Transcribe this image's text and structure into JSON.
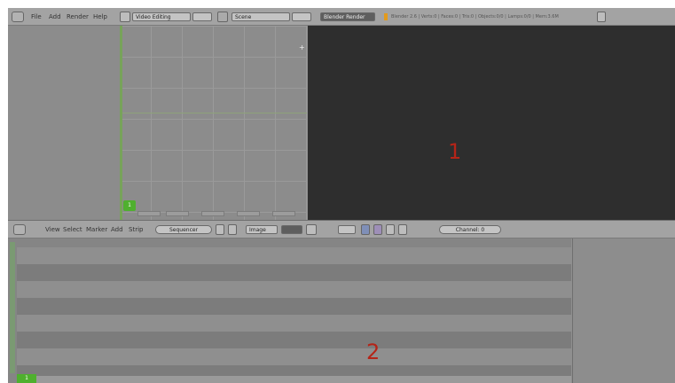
{
  "top_header": {
    "menus": [
      "File",
      "Add",
      "Render",
      "Help"
    ],
    "screen_layout": "Video Editing",
    "scene": "Scene",
    "render_engine": "Blender Render",
    "stats": "Blender 2.6 | Verts:0 | Faces:0 | Tris:0 | Objects:0/0 | Lamps:0/0 | Mem:3.6M"
  },
  "graph_editor": {
    "current_frame": "1",
    "y_ticks": [
      "",
      "",
      "",
      ""
    ]
  },
  "preview": {
    "annotation": "1"
  },
  "sequencer_header": {
    "menus": [
      "View",
      "Select",
      "Marker",
      "Add",
      "Strip"
    ],
    "view_type": "Sequencer",
    "display_mode": "Image",
    "channel": "Channel: 0",
    "ruler_labels": [
      "",
      "",
      "",
      "",
      "",
      "",
      "",
      "",
      "",
      "",
      "",
      "",
      "",
      "",
      "",
      ""
    ]
  },
  "sequencer": {
    "current_frame": "1",
    "annotation": "2"
  },
  "colors": {
    "frame_indicator": "#4fb02e",
    "annotation_red": "#b52418",
    "preview_bg": "#2e2e2e"
  }
}
